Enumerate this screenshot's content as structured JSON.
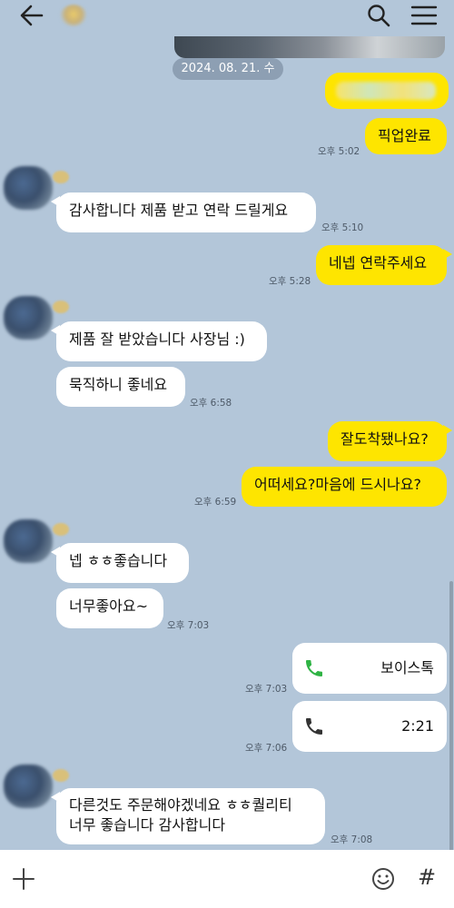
{
  "date_divider": "2024. 08. 21. 수",
  "messages": [
    {
      "id": "m1",
      "sender": "me",
      "text": "픽업완료",
      "time": "오후 5:02"
    },
    {
      "id": "m2",
      "sender": "other",
      "text": "감사합니다 제품 받고 연락 드릴게요",
      "time": "오후 5:10"
    },
    {
      "id": "m3",
      "sender": "me",
      "text": "네넵 연락주세요",
      "time": "오후 5:28"
    },
    {
      "id": "m4",
      "sender": "other",
      "text": "제품 잘 받았습니다 사장님 :)"
    },
    {
      "id": "m5",
      "sender": "other",
      "text": "묵직하니 좋네요",
      "time": "오후 6:58"
    },
    {
      "id": "m6",
      "sender": "me",
      "text": "잘도착됐나요?"
    },
    {
      "id": "m7",
      "sender": "me",
      "text": "어떠세요?마음에 드시나요?",
      "time": "오후 6:59"
    },
    {
      "id": "m8",
      "sender": "other",
      "text": "넵 ㅎㅎ좋습니다"
    },
    {
      "id": "m9",
      "sender": "other",
      "text": "너무좋아요~",
      "time": "오후 7:03"
    },
    {
      "id": "m10",
      "sender": "me",
      "type": "call",
      "text": "보이스톡",
      "time": "오후 7:03"
    },
    {
      "id": "m11",
      "sender": "me",
      "type": "call",
      "text": "2:21",
      "time": "오후 7:06"
    },
    {
      "id": "m12",
      "sender": "other",
      "text_line1": "다른것도 주문해야겠네요 ㅎㅎ퀄리티",
      "text_line2": "너무 좋습니다 감사합니다",
      "time": "오후 7:08"
    }
  ],
  "icons": {
    "back": "arrow-left-icon",
    "search": "search-icon",
    "menu": "hamburger-menu-icon",
    "call_green": "phone-icon",
    "call_dark": "phone-icon",
    "plus": "plus-icon",
    "emoji": "smiley-icon",
    "hash": "hash-icon"
  },
  "input_bar": {
    "hash_symbol": "#"
  },
  "colors": {
    "background": "#b3c6d9",
    "my_bubble": "#fee500",
    "other_bubble": "#ffffff",
    "call_green": "#2fb344"
  }
}
